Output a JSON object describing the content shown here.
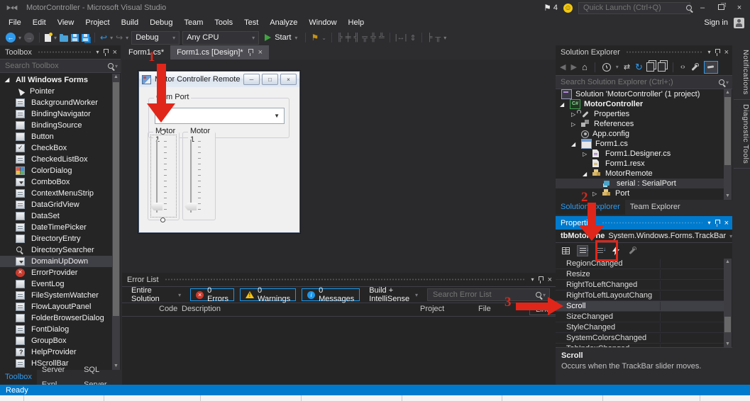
{
  "window": {
    "title": "MotorController - Microsoft Visual Studio",
    "quick_launch_placeholder": "Quick Launch (Ctrl+Q)",
    "notifications_count": "4",
    "sign_in_label": "Sign in"
  },
  "menu": {
    "items": [
      "File",
      "Edit",
      "View",
      "Project",
      "Build",
      "Debug",
      "Team",
      "Tools",
      "Test",
      "Analyze",
      "Window",
      "Help"
    ]
  },
  "toolbar": {
    "configuration": "Debug",
    "platform": "Any CPU",
    "start_label": "Start"
  },
  "toolbox": {
    "title": "Toolbox",
    "search_placeholder": "Search Toolbox",
    "group_label": "All Windows Forms",
    "items": [
      "Pointer",
      "BackgroundWorker",
      "BindingNavigator",
      "BindingSource",
      "Button",
      "CheckBox",
      "CheckedListBox",
      "ColorDialog",
      "ComboBox",
      "ContextMenuStrip",
      "DataGridView",
      "DataSet",
      "DateTimePicker",
      "DirectoryEntry",
      "DirectorySearcher",
      "DomainUpDown",
      "ErrorProvider",
      "EventLog",
      "FileSystemWatcher",
      "FlowLayoutPanel",
      "FolderBrowserDialog",
      "FontDialog",
      "GroupBox",
      "HelpProvider",
      "HScrollBar"
    ],
    "selected_item": "DomainUpDown",
    "tabs": [
      "Toolbox",
      "Server Expl...",
      "SQL Server..."
    ]
  },
  "editor": {
    "tabs": [
      "Form1.cs*",
      "Form1.cs [Design]*"
    ],
    "form": {
      "title": "Motor Controller Remote",
      "com_port_label": "Com Port",
      "motor_left_label": "Motor 1",
      "motor_right_label": "Motor 1"
    }
  },
  "error_list": {
    "title": "Error List",
    "scope": "Entire Solution",
    "errors_label": "0 Errors",
    "warnings_label": "0 Warnings",
    "messages_label": "0 Messages",
    "filter": "Build + IntelliSense",
    "search_placeholder": "Search Error List",
    "columns": [
      "Code",
      "Description",
      "Project",
      "File",
      "Line"
    ]
  },
  "solution_explorer": {
    "title": "Solution Explorer",
    "search_placeholder": "Search Solution Explorer (Ctrl+;)",
    "items": [
      {
        "label": "Solution 'MotorController' (1 project)"
      },
      {
        "label": "MotorController"
      },
      {
        "label": "Properties"
      },
      {
        "label": "References"
      },
      {
        "label": "App.config"
      },
      {
        "label": "Form1.cs"
      },
      {
        "label": "Form1.Designer.cs"
      },
      {
        "label": "Form1.resx"
      },
      {
        "label": "MotorRemote"
      },
      {
        "label": "serial : SerialPort"
      },
      {
        "label": "Port"
      }
    ],
    "tabs": [
      "Solution Explorer",
      "Team Explorer"
    ]
  },
  "properties": {
    "title": "Properties",
    "object_name": "tbMotorOne",
    "object_type": "System.Windows.Forms.TrackBar",
    "events": [
      "RegionChanged",
      "Resize",
      "RightToLeftChanged",
      "RightToLeftLayoutChang",
      "Scroll",
      "SizeChanged",
      "StyleChanged",
      "SystemColorsChanged",
      "TabIndexChanged"
    ],
    "selected_event": "Scroll",
    "description_title": "Scroll",
    "description_text": "Occurs when the TrackBar slider moves."
  },
  "side_tabs": [
    "Notifications",
    "Diagnostic Tools"
  ],
  "status_bar": {
    "text": "Ready"
  },
  "annotations": {
    "step1": "1",
    "step2": "2",
    "step3": "3"
  },
  "colors": {
    "accent_blue": "#007acc",
    "annotation_red": "#e0261a",
    "start_green": "#3fa33f",
    "warning_yellow": "#f6c211",
    "error_red": "#c93b2e",
    "message_blue": "#1c97ea",
    "active_tool_tab_blue": "#2d9bf0"
  }
}
